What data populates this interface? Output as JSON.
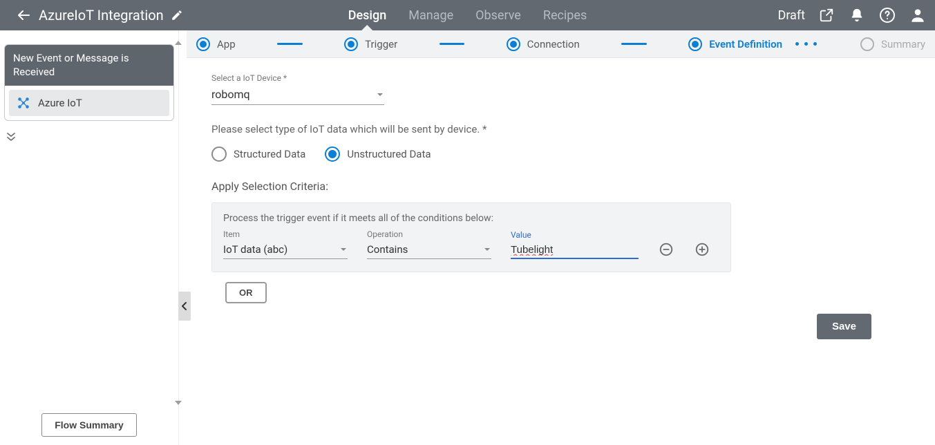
{
  "header": {
    "title": "AzureIoT Integration",
    "status": "Draft",
    "nav": {
      "design": "Design",
      "manage": "Manage",
      "observe": "Observe",
      "recipes": "Recipes"
    }
  },
  "sidebar": {
    "card_title": "New Event or Message is Received",
    "connector_label": "Azure IoT",
    "flow_summary_label": "Flow Summary"
  },
  "steps": {
    "app": "App",
    "trigger": "Trigger",
    "connection": "Connection",
    "event_definition": "Event Definition",
    "summary": "Summary"
  },
  "form": {
    "device_label": "Select a IoT Device *",
    "device_value": "robomq",
    "data_type_help": "Please select type of IoT data which will be sent by device. *",
    "radio_structured": "Structured Data",
    "radio_unstructured": "Unstructured Data",
    "criteria_title": "Apply Selection Criteria:",
    "criteria_help": "Process the trigger event if it meets all of the conditions below:",
    "col_item": "Item",
    "col_operation": "Operation",
    "col_value": "Value",
    "item_value": "IoT data  (abc)",
    "operation_value": "Contains",
    "value_value": "Tubelight",
    "or_label": "OR",
    "save_label": "Save"
  }
}
